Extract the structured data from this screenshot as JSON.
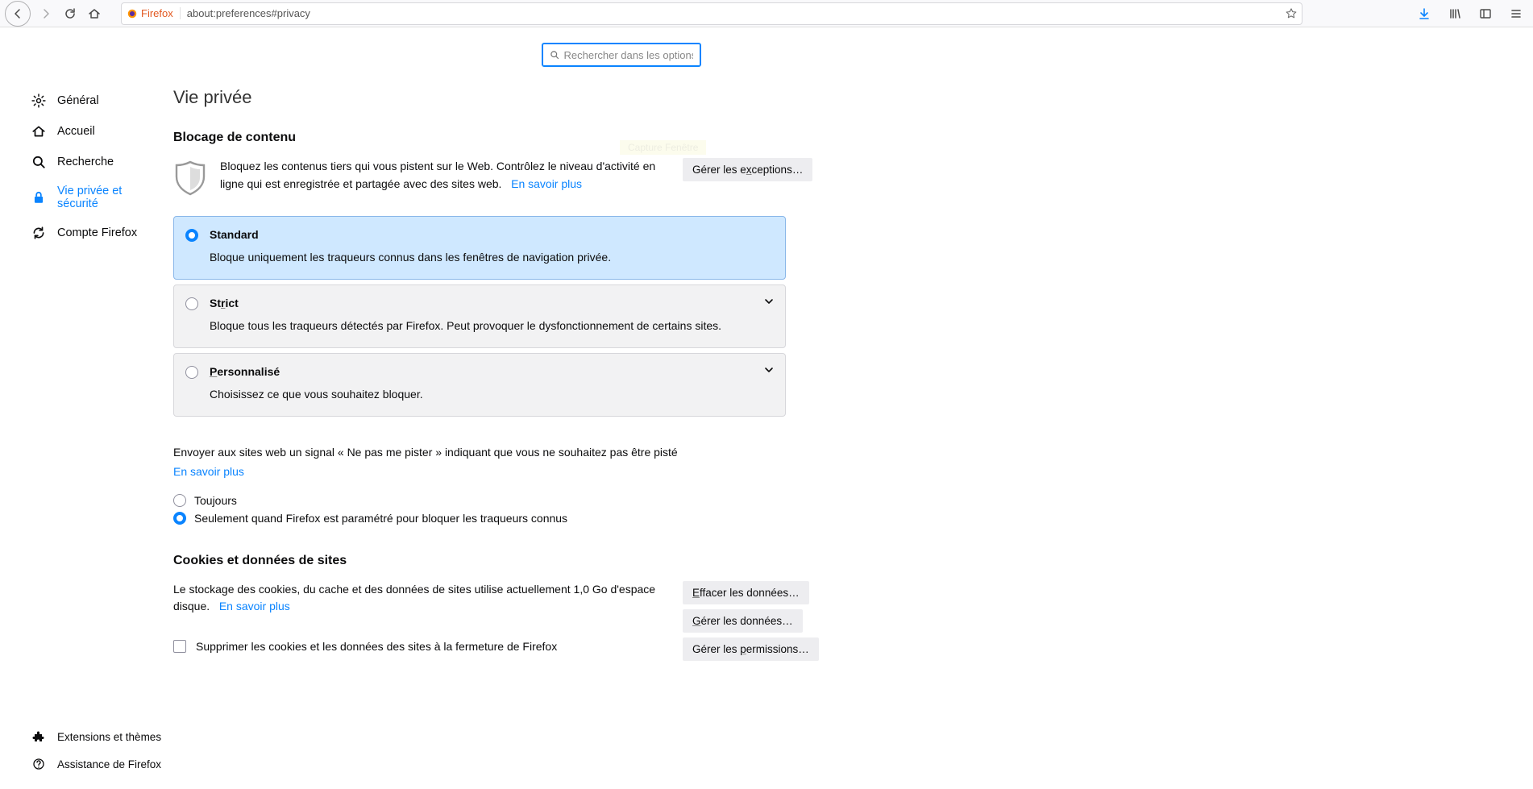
{
  "toolbar": {
    "identity_label": "Firefox",
    "url": "about:preferences#privacy"
  },
  "search": {
    "placeholder": "Rechercher dans les options"
  },
  "tooltip": "Capture Fenêtre",
  "sidebar": {
    "items": [
      {
        "label": "Général"
      },
      {
        "label": "Accueil"
      },
      {
        "label": "Recherche"
      },
      {
        "label": "Vie privée et sécurité"
      },
      {
        "label": "Compte Firefox"
      }
    ],
    "bottom": [
      {
        "label": "Extensions et thèmes"
      },
      {
        "label": "Assistance de Firefox"
      }
    ]
  },
  "page": {
    "title": "Vie privée",
    "blocking": {
      "heading": "Blocage de contenu",
      "description": "Bloquez les contenus tiers qui vous pistent sur le Web. Contrôlez le niveau d'activité en ligne qui est enregistrée et partagée avec des sites web.",
      "learn_more": "En savoir plus",
      "exceptions_btn": "Gérer les exceptions…",
      "exceptions_btn_accesskey": "x",
      "options": [
        {
          "title": "Standard",
          "desc": "Bloque uniquement les traqueurs connus dans les fenêtres de navigation privée.",
          "selected": true,
          "expandable": false
        },
        {
          "title_pre": "St",
          "title_u": "r",
          "title_post": "ict",
          "desc": "Bloque tous les traqueurs détectés par Firefox. Peut provoquer le dysfonctionnement de certains sites.",
          "selected": false,
          "expandable": true
        },
        {
          "title_pre": "",
          "title_u": "P",
          "title_post": "ersonnalisé",
          "desc": "Choisissez ce que vous souhaitez bloquer.",
          "selected": false,
          "expandable": true
        }
      ]
    },
    "dnt": {
      "text": "Envoyer aux sites web un signal « Ne pas me pister » indiquant que vous ne souhaitez pas être pisté",
      "learn_more": "En savoir plus",
      "options": [
        {
          "label": "Toujours",
          "checked": false
        },
        {
          "label": "Seulement quand Firefox est paramétré pour bloquer les traqueurs connus",
          "checked": true
        }
      ]
    },
    "cookies": {
      "heading": "Cookies et données de sites",
      "storage_text_1": "Le stockage des cookies, du cache et des données de sites utilise actuellement 1,0 Go d'espace disque.",
      "learn_more": "En savoir plus",
      "clear_pre": "",
      "clear_u": "E",
      "clear_post": "ffacer les données…",
      "manage_pre": "",
      "manage_u": "G",
      "manage_post": "érer les données…",
      "perm_pre": "Gérer les ",
      "perm_u": "p",
      "perm_post": "ermissions…",
      "delete_on_close": "Supprimer les cookies et les données des sites à la fermeture de Firefox"
    }
  }
}
